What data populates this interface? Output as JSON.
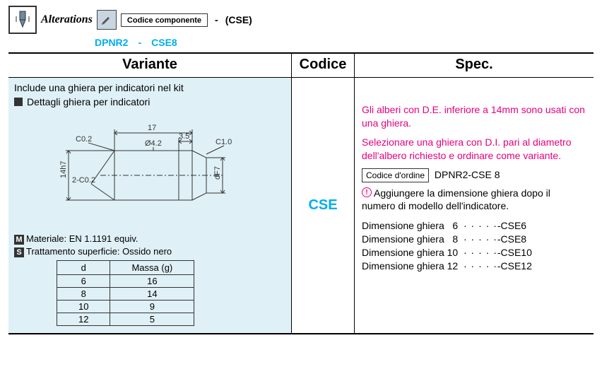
{
  "top": {
    "alterations": "Alterations",
    "codice_componente": "Codice componente",
    "cse": "(CSE)",
    "example_part": "DPNR2",
    "example_cse": "CSE8",
    "dash": "-"
  },
  "headers": {
    "variante": "Variante",
    "codice": "Codice",
    "spec": "Spec."
  },
  "left": {
    "include": "Include una ghiera per indicatori nel kit",
    "dettagli": "Dettagli ghiera per indicatori",
    "material_tag": "M",
    "material": "Materiale: EN 1.1191 equiv.",
    "surface_tag": "S",
    "surface": "Trattamento superficie: Ossido nero",
    "drawing": {
      "dim_17": "17",
      "dim_35": "3.5",
      "C02": "C0.2",
      "d42": "Ø4.2",
      "C10": "C1.0",
      "twoC02": "2-C0.2",
      "h147": "14h7",
      "dF7": "dF7"
    },
    "subtable": {
      "h_d": "d",
      "h_mass": "Massa (g)",
      "rows": [
        {
          "d": "6",
          "m": "16"
        },
        {
          "d": "8",
          "m": "14"
        },
        {
          "d": "10",
          "m": "9"
        },
        {
          "d": "12",
          "m": "5"
        }
      ]
    }
  },
  "mid": {
    "code": "CSE"
  },
  "right": {
    "magenta1": "Gli alberi con D.E. inferiore a 14mm sono usati con una ghiera.",
    "magenta2": "Selezionare una ghiera con D.I. pari al diametro dell'albero richiesto e ordinare come variante.",
    "order_box": "Codice d'ordine",
    "order_code": "DPNR2-CSE 8",
    "add_note": "Aggiungere la dimensione ghiera dopo il numero di modello dell'indicatore.",
    "sizes": [
      {
        "label": "Dimensione ghiera",
        "n": "6",
        "code": "-CSE6"
      },
      {
        "label": "Dimensione ghiera",
        "n": "8",
        "code": "-CSE8"
      },
      {
        "label": "Dimensione ghiera",
        "n": "10",
        "code": "-CSE10"
      },
      {
        "label": "Dimensione ghiera",
        "n": "12",
        "code": "-CSE12"
      }
    ],
    "dots": "· · · · ·"
  }
}
